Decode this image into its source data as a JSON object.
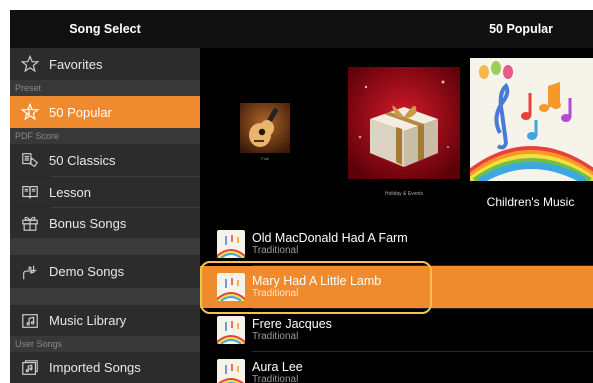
{
  "sidebar": {
    "title": "Song Select",
    "sections": {
      "preset": "Preset",
      "pdf_score": "PDF Score",
      "user_songs": "User Songs"
    },
    "items": {
      "favorites": "Favorites",
      "popular": "50 Popular",
      "classics": "50 Classics",
      "lesson": "Lesson",
      "bonus": "Bonus Songs",
      "demo": "Demo Songs",
      "music_library": "Music Library",
      "imported": "Imported Songs"
    },
    "selected": "popular"
  },
  "main": {
    "title": "50 Popular",
    "categories": {
      "folk": "Folk",
      "holiday": "Holiday & Events",
      "children": "Children's Music"
    },
    "songs": [
      {
        "title": "Old MacDonald Had A Farm",
        "subtitle": "Traditional"
      },
      {
        "title": "Mary Had A Little Lamb",
        "subtitle": "Traditional"
      },
      {
        "title": "Frere Jacques",
        "subtitle": "Traditional"
      },
      {
        "title": "Aura Lee",
        "subtitle": "Traditional"
      }
    ],
    "selected_song_index": 1
  },
  "colors": {
    "accent": "#f08a2e",
    "highlight_outline": "#f2c44d"
  }
}
